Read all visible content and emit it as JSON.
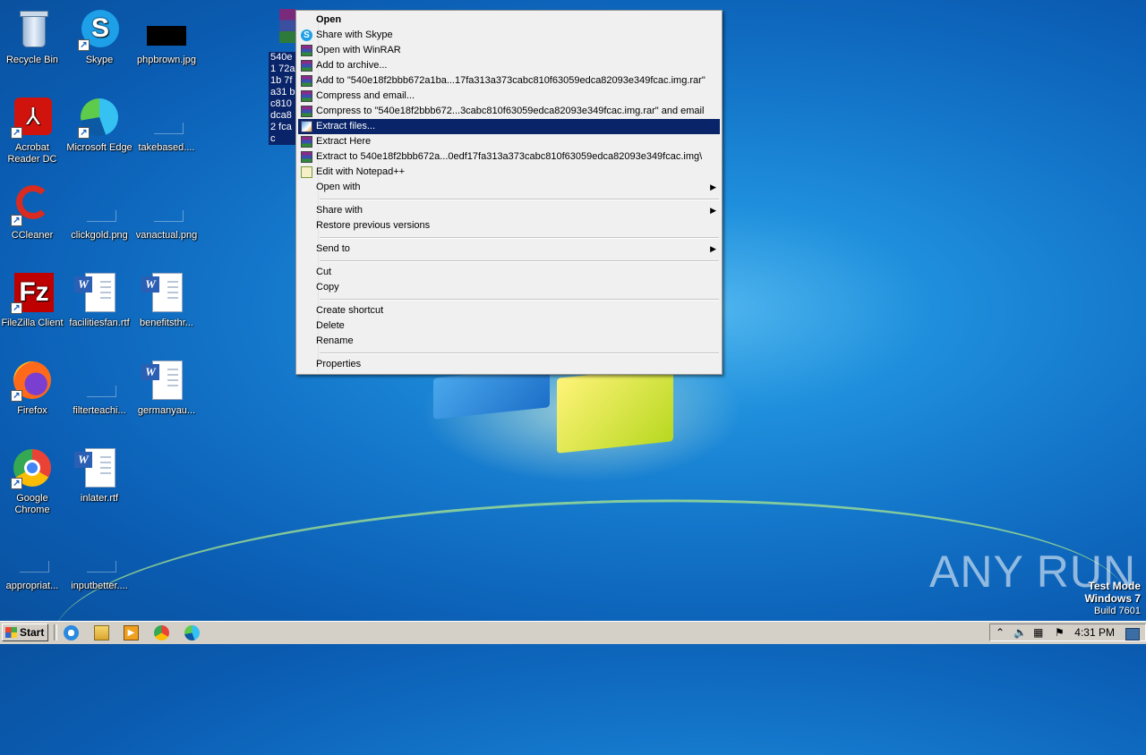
{
  "desktop": {
    "icons": [
      {
        "label": "Recycle Bin"
      },
      {
        "label": "Skype"
      },
      {
        "label": "phpbrown.jpg"
      },
      {
        "label": "Acrobat Reader DC"
      },
      {
        "label": "Microsoft Edge"
      },
      {
        "label": "takebased...."
      },
      {
        "label": "CCleaner"
      },
      {
        "label": "clickgold.png"
      },
      {
        "label": "vanactual.png"
      },
      {
        "label": "FileZilla Client"
      },
      {
        "label": "facilitiesfan.rtf"
      },
      {
        "label": "benefitsthr..."
      },
      {
        "label": "Firefox"
      },
      {
        "label": "filterteachi..."
      },
      {
        "label": "germanyau..."
      },
      {
        "label": "Google Chrome"
      },
      {
        "label": "inlater.rtf"
      },
      {
        "label": "appropriat..."
      },
      {
        "label": "inputbetter...."
      }
    ],
    "selected_file_label": "540e1 72a1b 7fa31 bc810 dca82 fcac"
  },
  "context_menu": {
    "items": [
      {
        "label": "Open",
        "icon": ""
      },
      {
        "label": "Share with Skype",
        "icon": "skype-icon"
      },
      {
        "label": "Open with WinRAR",
        "icon": "winrar-icon"
      },
      {
        "label": "Add to archive...",
        "icon": "winrar-icon"
      },
      {
        "label": "Add to \"540e18f2bbb672a1ba...17fa313a373cabc810f63059edca82093e349fcac.img.rar\"",
        "icon": "winrar-icon"
      },
      {
        "label": "Compress and email...",
        "icon": "winrar-icon"
      },
      {
        "label": "Compress to \"540e18f2bbb672...3cabc810f63059edca82093e349fcac.img.rar\" and email",
        "icon": "winrar-icon"
      },
      {
        "label": "Extract files...",
        "icon": "winrar-extract-icon"
      },
      {
        "label": "Extract Here",
        "icon": "winrar-icon"
      },
      {
        "label": "Extract to 540e18f2bbb672a...0edf17fa313a373cabc810f63059edca82093e349fcac.img\\",
        "icon": "winrar-icon"
      },
      {
        "label": "Edit with Notepad++",
        "icon": "notepadpp-icon"
      },
      {
        "label": "Open with",
        "icon": ""
      },
      {
        "label": "Share with",
        "icon": ""
      },
      {
        "label": "Restore previous versions",
        "icon": ""
      },
      {
        "label": "Send to",
        "icon": ""
      },
      {
        "label": "Cut",
        "icon": ""
      },
      {
        "label": "Copy",
        "icon": ""
      },
      {
        "label": "Create shortcut",
        "icon": ""
      },
      {
        "label": "Delete",
        "icon": ""
      },
      {
        "label": "Rename",
        "icon": ""
      },
      {
        "label": "Properties",
        "icon": ""
      }
    ],
    "highlighted": "Extract files..."
  },
  "watermark": {
    "brand": "ANY RUN",
    "mode_line1": "Test Mode",
    "mode_line2": "Windows 7",
    "mode_line3": "Build 7601"
  },
  "taskbar": {
    "start_label": "Start",
    "pinned": [
      "internet-explorer-icon",
      "file-explorer-icon",
      "media-player-icon",
      "chrome-icon",
      "edge-icon"
    ],
    "clock": "4:31 PM"
  },
  "colors": {
    "desktop_blue": "#1374c8",
    "menu_highlight": "#0a246a",
    "taskbar": "#d4d0c8"
  }
}
